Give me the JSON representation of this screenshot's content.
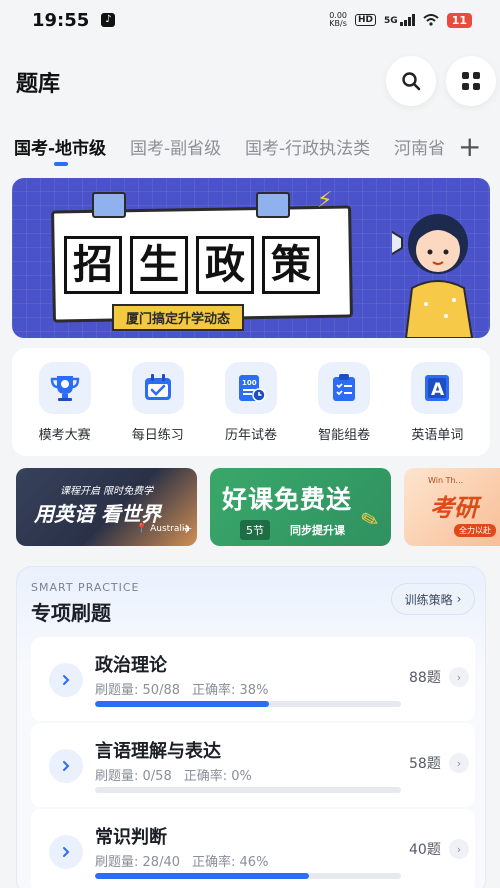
{
  "status_bar": {
    "time": "19:55",
    "net_speed": "0.00",
    "net_unit": "KB/s",
    "hd": "HD",
    "network": "5G",
    "battery": "11"
  },
  "header": {
    "title": "题库",
    "search_icon": "search-icon",
    "apps_icon": "grid-icon"
  },
  "tabs": [
    {
      "label": "国考-地市级",
      "active": true
    },
    {
      "label": "国考-副省级",
      "active": false
    },
    {
      "label": "国考-行政执法类",
      "active": false
    },
    {
      "label": "河南省",
      "active": false
    }
  ],
  "tab_add": "+",
  "banner": {
    "chars": [
      "招",
      "生",
      "政",
      "策"
    ],
    "subtitle": "厦门搞定升学动态"
  },
  "tools": [
    {
      "label": "模考大赛",
      "icon": "trophy-icon"
    },
    {
      "label": "每日练习",
      "icon": "calendar-check-icon"
    },
    {
      "label": "历年试卷",
      "icon": "exam-paper-icon"
    },
    {
      "label": "智能组卷",
      "icon": "clipboard-list-icon"
    },
    {
      "label": "英语单词",
      "icon": "letter-a-icon"
    }
  ],
  "promos": {
    "card1": {
      "small": "课程开启 限时免费学",
      "big": "用英语 看世界",
      "tag": "Australia"
    },
    "card2": {
      "big": "好课免费送",
      "pill": "5节",
      "small": "同步提升课"
    },
    "card3": {
      "top": "Win Th...",
      "big": "考研",
      "tag": "全力以赴"
    }
  },
  "practice": {
    "en_label": "SMART PRACTICE",
    "title": "专项刷题",
    "strategy_label": "训练策略",
    "strategy_arrow": "›",
    "stat_done_label": "刷题量:",
    "stat_acc_label": "正确率:",
    "items": [
      {
        "name": "政治理论",
        "done": "50/88",
        "accuracy": "38%",
        "count": "88题",
        "progress": 0.57
      },
      {
        "name": "言语理解与表达",
        "done": "0/58",
        "accuracy": "0%",
        "count": "58题",
        "progress": 0.0
      },
      {
        "name": "常识判断",
        "done": "28/40",
        "accuracy": "46%",
        "count": "40题",
        "progress": 0.7
      }
    ]
  },
  "colors": {
    "accent": "#2c6df5",
    "banner_bg": "#4a53c9",
    "battery": "#e84c3d",
    "tool_bg": "#eaf1fd"
  }
}
